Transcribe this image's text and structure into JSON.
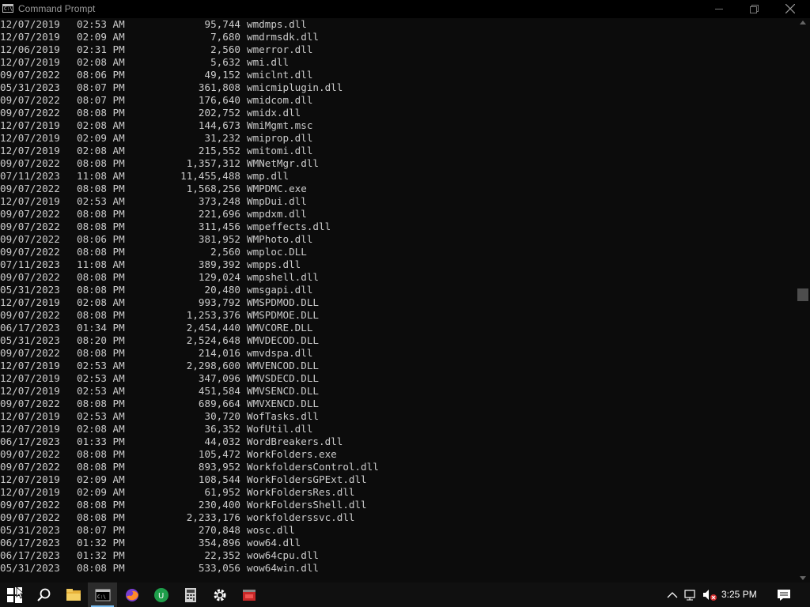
{
  "window": {
    "title": "Command Prompt",
    "icon_text": "C:\\"
  },
  "listing": [
    {
      "date": "12/07/2019",
      "time": "02:53 AM",
      "size": "95,744",
      "name": "wmdmps.dll"
    },
    {
      "date": "12/07/2019",
      "time": "02:09 AM",
      "size": "7,680",
      "name": "wmdrmsdk.dll"
    },
    {
      "date": "12/06/2019",
      "time": "02:31 PM",
      "size": "2,560",
      "name": "wmerror.dll"
    },
    {
      "date": "12/07/2019",
      "time": "02:08 AM",
      "size": "5,632",
      "name": "wmi.dll"
    },
    {
      "date": "09/07/2022",
      "time": "08:06 PM",
      "size": "49,152",
      "name": "wmiclnt.dll"
    },
    {
      "date": "05/31/2023",
      "time": "08:07 PM",
      "size": "361,808",
      "name": "wmicmiplugin.dll"
    },
    {
      "date": "09/07/2022",
      "time": "08:07 PM",
      "size": "176,640",
      "name": "wmidcom.dll"
    },
    {
      "date": "09/07/2022",
      "time": "08:08 PM",
      "size": "202,752",
      "name": "wmidx.dll"
    },
    {
      "date": "12/07/2019",
      "time": "02:08 AM",
      "size": "144,673",
      "name": "WmiMgmt.msc"
    },
    {
      "date": "12/07/2019",
      "time": "02:09 AM",
      "size": "31,232",
      "name": "wmiprop.dll"
    },
    {
      "date": "12/07/2019",
      "time": "02:08 AM",
      "size": "215,552",
      "name": "wmitomi.dll"
    },
    {
      "date": "09/07/2022",
      "time": "08:08 PM",
      "size": "1,357,312",
      "name": "WMNetMgr.dll"
    },
    {
      "date": "07/11/2023",
      "time": "11:08 AM",
      "size": "11,455,488",
      "name": "wmp.dll"
    },
    {
      "date": "09/07/2022",
      "time": "08:08 PM",
      "size": "1,568,256",
      "name": "WMPDMC.exe"
    },
    {
      "date": "12/07/2019",
      "time": "02:53 AM",
      "size": "373,248",
      "name": "WmpDui.dll"
    },
    {
      "date": "09/07/2022",
      "time": "08:08 PM",
      "size": "221,696",
      "name": "wmpdxm.dll"
    },
    {
      "date": "09/07/2022",
      "time": "08:08 PM",
      "size": "311,456",
      "name": "wmpeffects.dll"
    },
    {
      "date": "09/07/2022",
      "time": "08:06 PM",
      "size": "381,952",
      "name": "WMPhoto.dll"
    },
    {
      "date": "09/07/2022",
      "time": "08:08 PM",
      "size": "2,560",
      "name": "wmploc.DLL"
    },
    {
      "date": "07/11/2023",
      "time": "11:08 AM",
      "size": "389,392",
      "name": "wmpps.dll"
    },
    {
      "date": "09/07/2022",
      "time": "08:08 PM",
      "size": "129,024",
      "name": "wmpshell.dll"
    },
    {
      "date": "05/31/2023",
      "time": "08:08 PM",
      "size": "20,480",
      "name": "wmsgapi.dll"
    },
    {
      "date": "12/07/2019",
      "time": "02:08 AM",
      "size": "993,792",
      "name": "WMSPDMOD.DLL"
    },
    {
      "date": "09/07/2022",
      "time": "08:08 PM",
      "size": "1,253,376",
      "name": "WMSPDMOE.DLL"
    },
    {
      "date": "06/17/2023",
      "time": "01:34 PM",
      "size": "2,454,440",
      "name": "WMVCORE.DLL"
    },
    {
      "date": "05/31/2023",
      "time": "08:20 PM",
      "size": "2,524,648",
      "name": "WMVDECOD.DLL"
    },
    {
      "date": "09/07/2022",
      "time": "08:08 PM",
      "size": "214,016",
      "name": "wmvdspa.dll"
    },
    {
      "date": "12/07/2019",
      "time": "02:53 AM",
      "size": "2,298,600",
      "name": "WMVENCOD.DLL"
    },
    {
      "date": "12/07/2019",
      "time": "02:53 AM",
      "size": "347,096",
      "name": "WMVSDECD.DLL"
    },
    {
      "date": "12/07/2019",
      "time": "02:53 AM",
      "size": "451,584",
      "name": "WMVSENCD.DLL"
    },
    {
      "date": "09/07/2022",
      "time": "08:08 PM",
      "size": "689,664",
      "name": "WMVXENCD.DLL"
    },
    {
      "date": "12/07/2019",
      "time": "02:53 AM",
      "size": "30,720",
      "name": "WofTasks.dll"
    },
    {
      "date": "12/07/2019",
      "time": "02:08 AM",
      "size": "36,352",
      "name": "WofUtil.dll"
    },
    {
      "date": "06/17/2023",
      "time": "01:33 PM",
      "size": "44,032",
      "name": "WordBreakers.dll"
    },
    {
      "date": "09/07/2022",
      "time": "08:08 PM",
      "size": "105,472",
      "name": "WorkFolders.exe"
    },
    {
      "date": "09/07/2022",
      "time": "08:08 PM",
      "size": "893,952",
      "name": "WorkfoldersControl.dll"
    },
    {
      "date": "12/07/2019",
      "time": "02:09 AM",
      "size": "108,544",
      "name": "WorkFoldersGPExt.dll"
    },
    {
      "date": "12/07/2019",
      "time": "02:09 AM",
      "size": "61,952",
      "name": "WorkFoldersRes.dll"
    },
    {
      "date": "09/07/2022",
      "time": "08:08 PM",
      "size": "230,400",
      "name": "WorkFoldersShell.dll"
    },
    {
      "date": "09/07/2022",
      "time": "08:08 PM",
      "size": "2,233,176",
      "name": "workfolderssvc.dll"
    },
    {
      "date": "05/31/2023",
      "time": "08:07 PM",
      "size": "270,848",
      "name": "wosc.dll"
    },
    {
      "date": "06/17/2023",
      "time": "01:32 PM",
      "size": "354,896",
      "name": "wow64.dll"
    },
    {
      "date": "06/17/2023",
      "time": "01:32 PM",
      "size": "22,352",
      "name": "wow64cpu.dll"
    },
    {
      "date": "05/31/2023",
      "time": "08:08 PM",
      "size": "533,056",
      "name": "wow64win.dll"
    }
  ],
  "scrollbar": {
    "position_fraction": 0.49
  },
  "taskbar": {
    "items": [
      "start-icon",
      "search-icon",
      "file-explorer-icon",
      "command-prompt-icon",
      "firefox-icon",
      "green-u-app-icon",
      "calculator-icon",
      "settings-gear-icon",
      "red-app-icon"
    ],
    "tray": [
      "chevron-up-icon",
      "network-icon",
      "volume-muted-icon",
      "notification-icon"
    ],
    "clock": "3:25 PM"
  },
  "colors": {
    "console_bg": "#0c0c0c",
    "console_fg": "#cccccc",
    "taskbar_bg": "#101010"
  }
}
